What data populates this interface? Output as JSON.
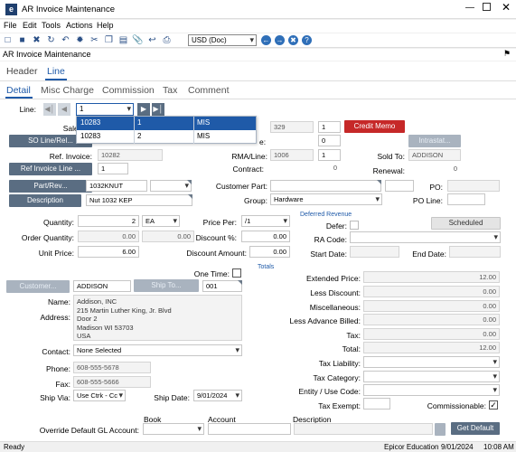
{
  "window": {
    "title": "AR Invoice Maintenance",
    "app_icon": "epicor-icon"
  },
  "menu": {
    "items": [
      "File",
      "Edit",
      "Tools",
      "Actions",
      "Help"
    ]
  },
  "toolbar": {
    "currency": "USD (Doc)"
  },
  "form_title": "AR Invoice Maintenance",
  "tabs_top": [
    "Header",
    "Line"
  ],
  "tabs_sub": [
    "Detail",
    "Misc Charge",
    "Commission",
    "Tax",
    "Comment"
  ],
  "line": {
    "label": "Line:",
    "value": "1"
  },
  "dropdown": {
    "rows": [
      {
        "invoice": "10283",
        "line": "1",
        "type": "MIS"
      },
      {
        "invoice": "10283",
        "line": "2",
        "type": "MIS"
      }
    ]
  },
  "left": {
    "sales_label": "Sales O",
    "so_line_btn": "SO Line/Rel...",
    "ref_invoice_label": "Ref. Invoice:",
    "ref_invoice_value": "10282",
    "ref_line_btn": "Ref Invoice Line ...",
    "ref_line_value": "1",
    "part_btn": "Part/Rev...",
    "part_value": "1032KNUT",
    "desc_btn": "Description",
    "desc_value": "Nut 1032 KEP"
  },
  "middle": {
    "ship_suffix": "e:",
    "ship_value": "329",
    "ship_line": "1",
    "credit_memo_btn": "Credit Memo",
    "rel_value": "0",
    "rma_label": "RMA/Line:",
    "rma_value": "1006",
    "rma_line": "1",
    "contract_label": "Contract:",
    "contract_value": "0",
    "customer_part_label": "Customer Part:",
    "group_label": "Group:",
    "group_value": "Hardware"
  },
  "right_top": {
    "intrastat_btn": "Intrastat...",
    "sold_to_label": "Sold To:",
    "sold_to_value": "ADDISON",
    "renewal_label": "Renewal:",
    "renewal_value": "0",
    "po_label": "PO:",
    "po_line_label": "PO Line:"
  },
  "qty": {
    "quantity_label": "Quantity:",
    "quantity_value": "2",
    "uom": "EA",
    "order_qty_label": "Order Quantity:",
    "order_qty_value": "0.00",
    "order_qty_value2": "0.00",
    "unit_price_label": "Unit Price:",
    "unit_price_value": "6.00",
    "price_per_label": "Price Per:",
    "price_per_value": "/1",
    "discount_pct_label": "Discount %:",
    "discount_pct_value": "0.00",
    "discount_amt_label": "Discount Amount:",
    "discount_amt_value": "0.00"
  },
  "deferred": {
    "title": "Deferred Revenue",
    "defer_label": "Defer:",
    "scheduled_btn": "Scheduled",
    "ra_code_label": "RA Code:",
    "start_label": "Start Date:",
    "end_label": "End Date:"
  },
  "customer": {
    "one_time_label": "One Time:",
    "customer_btn": "Customer...",
    "customer_value": "ADDISON",
    "ship_to_btn": "Ship To...",
    "ship_to_value": "001",
    "name_label": "Name:",
    "name_value": "Addison, INC",
    "address_label": "Address:",
    "address_lines": [
      "215 Martin Luther King, Jr. Blvd",
      "Door 2",
      "Madison WI 53703",
      "USA"
    ],
    "contact_label": "Contact:",
    "contact_value": "None Selected",
    "phone_label": "Phone:",
    "phone_value": "608-555-5678",
    "fax_label": "Fax:",
    "fax_value": "608-555-5666",
    "ship_via_label": "Ship Via:",
    "ship_via_value": "Use Ctrk - Cc",
    "ship_date_label": "Ship Date:",
    "ship_date_value": "9/01/2024"
  },
  "totals": {
    "title": "Totals",
    "rows": [
      {
        "label": "Extended Price:",
        "value": "12.00"
      },
      {
        "label": "Less Discount:",
        "value": "0.00"
      },
      {
        "label": "Miscellaneous:",
        "value": "0.00"
      },
      {
        "label": "Less Advance Billed:",
        "value": "0.00"
      },
      {
        "label": "Tax:",
        "value": "0.00"
      },
      {
        "label": "Total:",
        "value": "12.00"
      }
    ],
    "tax_liability_label": "Tax Liability:",
    "tax_category_label": "Tax Category:",
    "entity_use_label": "Entity / Use Code:",
    "tax_exempt_label": "Tax Exempt:",
    "commissionable_label": "Commissionable:"
  },
  "gl": {
    "book_header": "Book",
    "account_header": "Account",
    "description_header": "Description",
    "override_label": "Override Default GL Account:",
    "get_default_btn": "Get Default"
  },
  "status": {
    "left": "Ready",
    "company": "Epicor Education",
    "date": "9/01/2024",
    "time": "10:08 AM"
  },
  "colors": {
    "accent": "#1f5aa8",
    "title_bar": "#ffffff",
    "button": "#5a6d82",
    "credit_memo": "#c62828",
    "dropdown_highlight": "#1f5aa8"
  }
}
